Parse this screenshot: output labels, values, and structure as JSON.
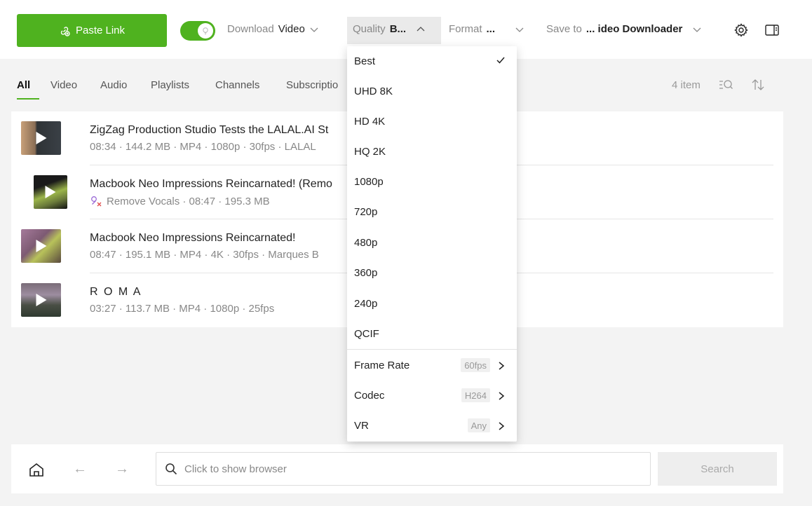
{
  "toolbar": {
    "paste_label": "Paste Link",
    "download_label": "Download",
    "download_value": "Video",
    "quality_label": "Quality",
    "quality_value": "B...",
    "format_label": "Format",
    "format_value": "...",
    "save_label": "Save to",
    "save_value": "... ideo Downloader"
  },
  "tabs": [
    "All",
    "Video",
    "Audio",
    "Playlists",
    "Channels",
    "Subscriptio"
  ],
  "item_count": "4 item",
  "items": [
    {
      "title": "ZigZag Production Studio Tests the LALAL.AI St",
      "meta": "08:34 · 144.2 MB · MP4 · 1080p · 30fps · LALAL"
    },
    {
      "title": "Macbook Neo Impressions Reincarnated! (Remo",
      "meta": "Remove Vocals · 08:47 · 195.3 MB"
    },
    {
      "title": "Macbook Neo Impressions Reincarnated!",
      "meta": "08:47 · 195.1 MB · MP4 · 4K · 30fps · Marques B"
    },
    {
      "title": "R O M A",
      "meta": "03:27 · 113.7 MB · MP4 · 1080p · 25fps"
    }
  ],
  "dropdown": {
    "options": [
      "Best",
      "UHD 8K",
      "HD 4K",
      "HQ 2K",
      "1080p",
      "720p",
      "480p",
      "360p",
      "240p",
      "QCIF"
    ],
    "selected": "Best",
    "submenus": [
      {
        "label": "Frame Rate",
        "value": "60fps"
      },
      {
        "label": "Codec",
        "value": "H264"
      },
      {
        "label": "VR",
        "value": "Any"
      }
    ]
  },
  "bottom": {
    "url_placeholder": "Click to show browser",
    "search_label": "Search"
  },
  "colors": {
    "accent": "#4fb21f"
  }
}
